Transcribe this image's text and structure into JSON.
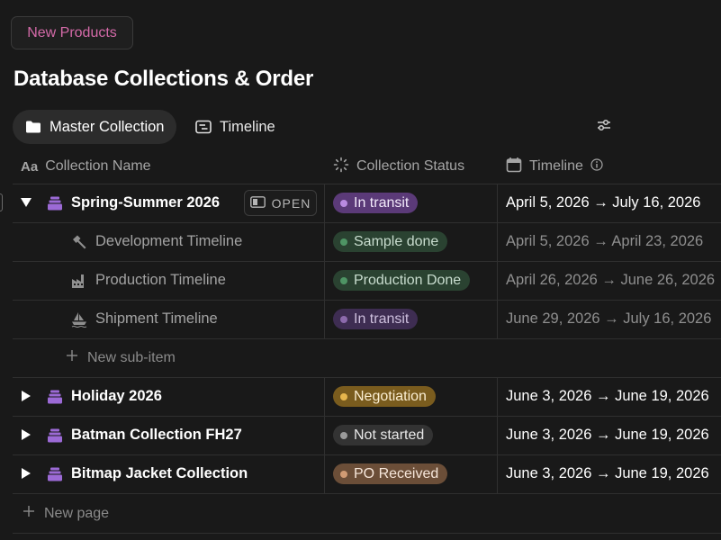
{
  "header_chip": "New Products",
  "page_title": "Database Collections & Order",
  "views": [
    {
      "label": "Master Collection",
      "icon": "folder-icon",
      "active": true
    },
    {
      "label": "Timeline",
      "icon": "timeline-icon",
      "active": false
    }
  ],
  "columns": {
    "name": "Collection Name",
    "status": "Collection Status",
    "timeline": "Timeline"
  },
  "open_button": "OPEN",
  "colors": {
    "in_transit": {
      "bg": "#5b3a78",
      "dot": "#b98ae0",
      "text": "#f2e9fa"
    },
    "sample_done": {
      "bg": "#2c4a35",
      "dot": "#5aa873",
      "text": "#d6ecdc"
    },
    "production_done": {
      "bg": "#2c4a35",
      "dot": "#5aa873",
      "text": "#d6ecdc"
    },
    "negotiation": {
      "bg": "#7a5c1e",
      "dot": "#e6b64d",
      "text": "#fbeed2"
    },
    "not_started": {
      "bg": "#333333",
      "dot": "#9b9b9b",
      "text": "#e8e8e8"
    },
    "po_received": {
      "bg": "#6b4e38",
      "dot": "#d19b74",
      "text": "#f6e6da"
    }
  },
  "rows": [
    {
      "name": "Spring-Summer 2026",
      "status": "In transit",
      "dates": "April 5, 2026 → July 16, 2026"
    },
    {
      "name": "Development Timeline",
      "status": "Sample done",
      "dates": "April 5, 2026 → April 23, 2026"
    },
    {
      "name": "Production Timeline",
      "status": "Production Done",
      "dates": "April 26, 2026 → June 26, 2026"
    },
    {
      "name": "Shipment Timeline",
      "status": "In transit",
      "dates": "June 29, 2026 → July 16, 2026"
    },
    {
      "name": "Holiday 2026",
      "status": "Negotiation",
      "dates": "June 3, 2026 → June 19, 2026"
    },
    {
      "name": "Batman Collection FH27",
      "status": "Not started",
      "dates": "June 3, 2026 → June 19, 2026"
    },
    {
      "name": "Bitmap Jacket Collection",
      "status": "PO Received",
      "dates": "June 3, 2026 → June 19, 2026"
    }
  ],
  "new_sub_item": "New sub-item",
  "new_page": "New page"
}
